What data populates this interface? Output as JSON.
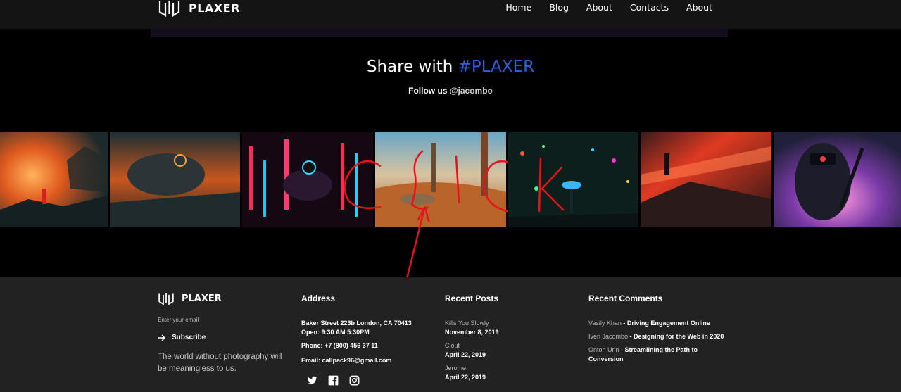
{
  "brand": {
    "name": "PLAXER"
  },
  "nav": {
    "items": [
      "Home",
      "Blog",
      "About",
      "Contacts",
      "About"
    ]
  },
  "share": {
    "title_prefix": "Share with",
    "title_hashtag": "#PLAXER",
    "follow_prefix": "Follow us",
    "follow_handle": "@jacombo"
  },
  "gallery": {
    "count": 7,
    "annotation_text": "CLICK",
    "annotation_color": "#e3151a"
  },
  "footer": {
    "logo_text": "PLAXER",
    "email_placeholder": "Enter your email",
    "subscribe_label": "Subscribe",
    "tagline": "The world without photography will be meaningless to us.",
    "address": {
      "heading": "Address",
      "line1": "Baker Street 223b London, CA 70413",
      "line2": "Open: 9:30 AM 5:30PM",
      "phone": "Phone: +7 (800) 456 37 11",
      "email": "Email: callpack96@gmail.com"
    },
    "social_icons": [
      "twitter-icon",
      "facebook-icon",
      "instagram-icon"
    ],
    "recent_posts": {
      "heading": "Recent Posts",
      "items": [
        {
          "title": "Kills You Slowly",
          "date": "November 8, 2019"
        },
        {
          "title": "Clout",
          "date": "April 22, 2019"
        },
        {
          "title": "Jerome",
          "date": "April 22, 2019"
        }
      ]
    },
    "recent_comments": {
      "heading": "Recent Comments",
      "items": [
        {
          "author": "Vasily Khan",
          "post": "Driving Engagement Online"
        },
        {
          "author": "Iven Jacombo",
          "post": "Designing for the Web in 2020"
        },
        {
          "author": "Onton Urin",
          "post": "Streamlining the Path to Conversion"
        }
      ]
    }
  },
  "colors": {
    "accent": "#2f5fe0",
    "footer_bg": "#222222",
    "header_bg": "#141414"
  }
}
